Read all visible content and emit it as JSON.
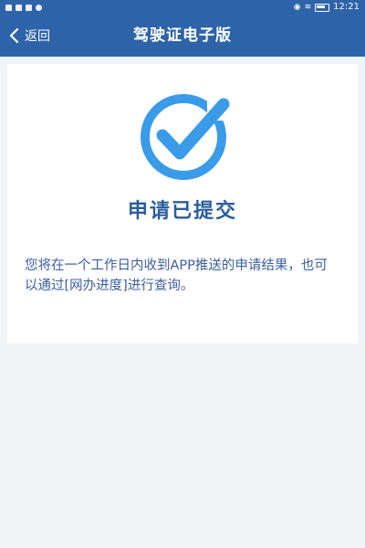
{
  "status_bar": {
    "time": "12:21"
  },
  "nav": {
    "back_label": "返回",
    "title": "驾驶证电子版"
  },
  "result": {
    "title": "申请已提交",
    "description": "您将在一个工作日内收到APP推送的申请结果，也可以通过[网办进度]进行查询。"
  },
  "colors": {
    "header_bg": "#2d63a8",
    "check_blue": "#3a9be8",
    "title_blue": "#2a5d9c",
    "page_bg": "#f2f5f8"
  },
  "icons": {
    "back": "chevron-left-icon",
    "success": "check-circle-icon"
  }
}
